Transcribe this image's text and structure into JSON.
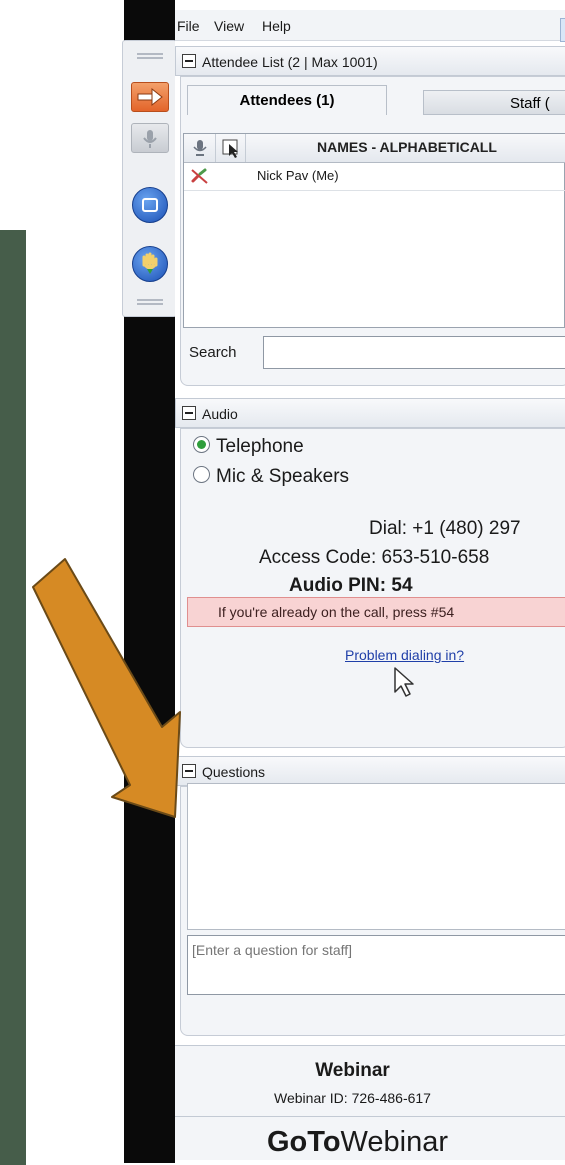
{
  "menu": {
    "items": [
      "File",
      "View",
      "Help"
    ]
  },
  "attendee_list": {
    "title": "Attendee List  (2 | Max 1001)",
    "tabs": [
      {
        "label": "Attendees (1)",
        "active": true
      },
      {
        "label": "Staff (",
        "active": false
      }
    ],
    "header_label": "NAMES - ALPHABETICALL",
    "rows": [
      {
        "name": "Nick Pav (Me)"
      }
    ],
    "search_label": "Search",
    "search_value": ""
  },
  "audio": {
    "title": "Audio",
    "options": [
      {
        "label": "Telephone",
        "selected": true
      },
      {
        "label": "Mic & Speakers",
        "selected": false
      }
    ],
    "dial_label": "Dial:",
    "dial_value": "+1 (480) 297",
    "access_label": "Access Code:",
    "access_value": "653-510-658",
    "pin_label": "Audio PIN:",
    "pin_value": "54",
    "notice": "If you're already on the call, press #54",
    "problem_link": "Problem dialing in?"
  },
  "questions": {
    "title": "Questions",
    "input_placeholder": "[Enter a question for staff]"
  },
  "footer": {
    "title": "Webinar",
    "webinar_id": "Webinar ID: 726-486-617",
    "logo_bold": "GoTo",
    "logo_regular": "Webinar"
  },
  "colors": {
    "background_panel": "#465d4a",
    "arrow": "#d68a24",
    "notice_bg": "#f8d3d3",
    "link": "#1f3fa8",
    "radio_selected": "#2f9e3c"
  },
  "icons": [
    "orange-arrow-icon",
    "microphone-icon",
    "screen-icon",
    "raise-hand-icon",
    "mic-column-icon",
    "cursor-column-icon",
    "muted-phone-icon",
    "pointer-cursor-icon"
  ]
}
